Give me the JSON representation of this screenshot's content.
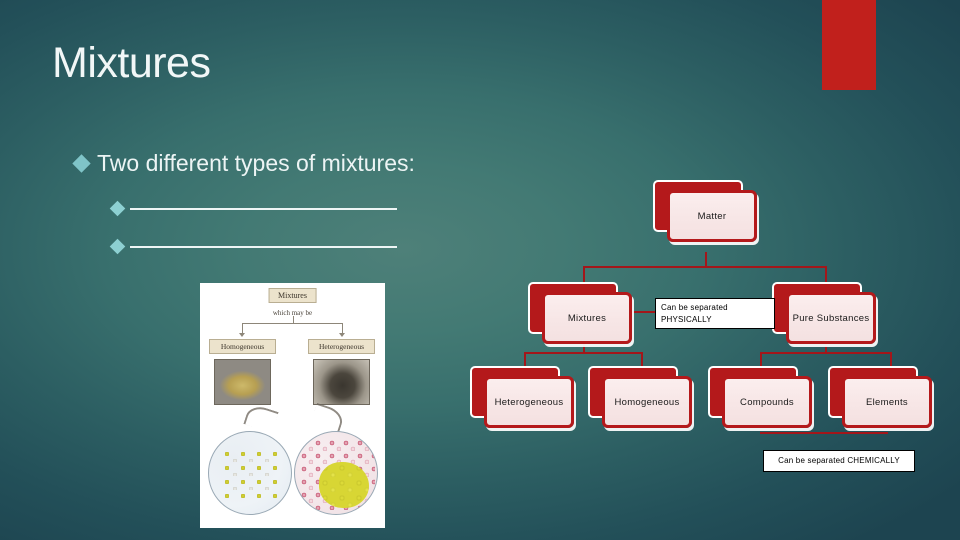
{
  "slide": {
    "title": "Mixtures",
    "accent_color": "#c1201c",
    "background_color": "#3a6f6c"
  },
  "bullets": {
    "level1": "Two different types of mixtures:",
    "level2": [
      "",
      ""
    ]
  },
  "picture": {
    "title": "Mixtures",
    "subtitle": "which may be",
    "left_label": "Homogeneous",
    "right_label": "Heterogeneous"
  },
  "diagram": {
    "nodes": [
      {
        "id": "matter",
        "label": "Matter"
      },
      {
        "id": "mixtures",
        "label": "Mixtures"
      },
      {
        "id": "pure-substances",
        "label": "Pure Substances"
      },
      {
        "id": "heterogeneous",
        "label": "Heterogeneous"
      },
      {
        "id": "homogeneous",
        "label": "Homogeneous"
      },
      {
        "id": "compounds",
        "label": "Compounds"
      },
      {
        "id": "elements",
        "label": "Elements"
      }
    ],
    "callouts": [
      {
        "id": "physically",
        "line1": "Can be separated",
        "line2": "PHYSICALLY"
      },
      {
        "id": "chemically",
        "line1": "Can be separated CHEMICALLY",
        "line2": ""
      }
    ],
    "node_fill": "#f7e6e6",
    "node_border": "#b4191b"
  }
}
